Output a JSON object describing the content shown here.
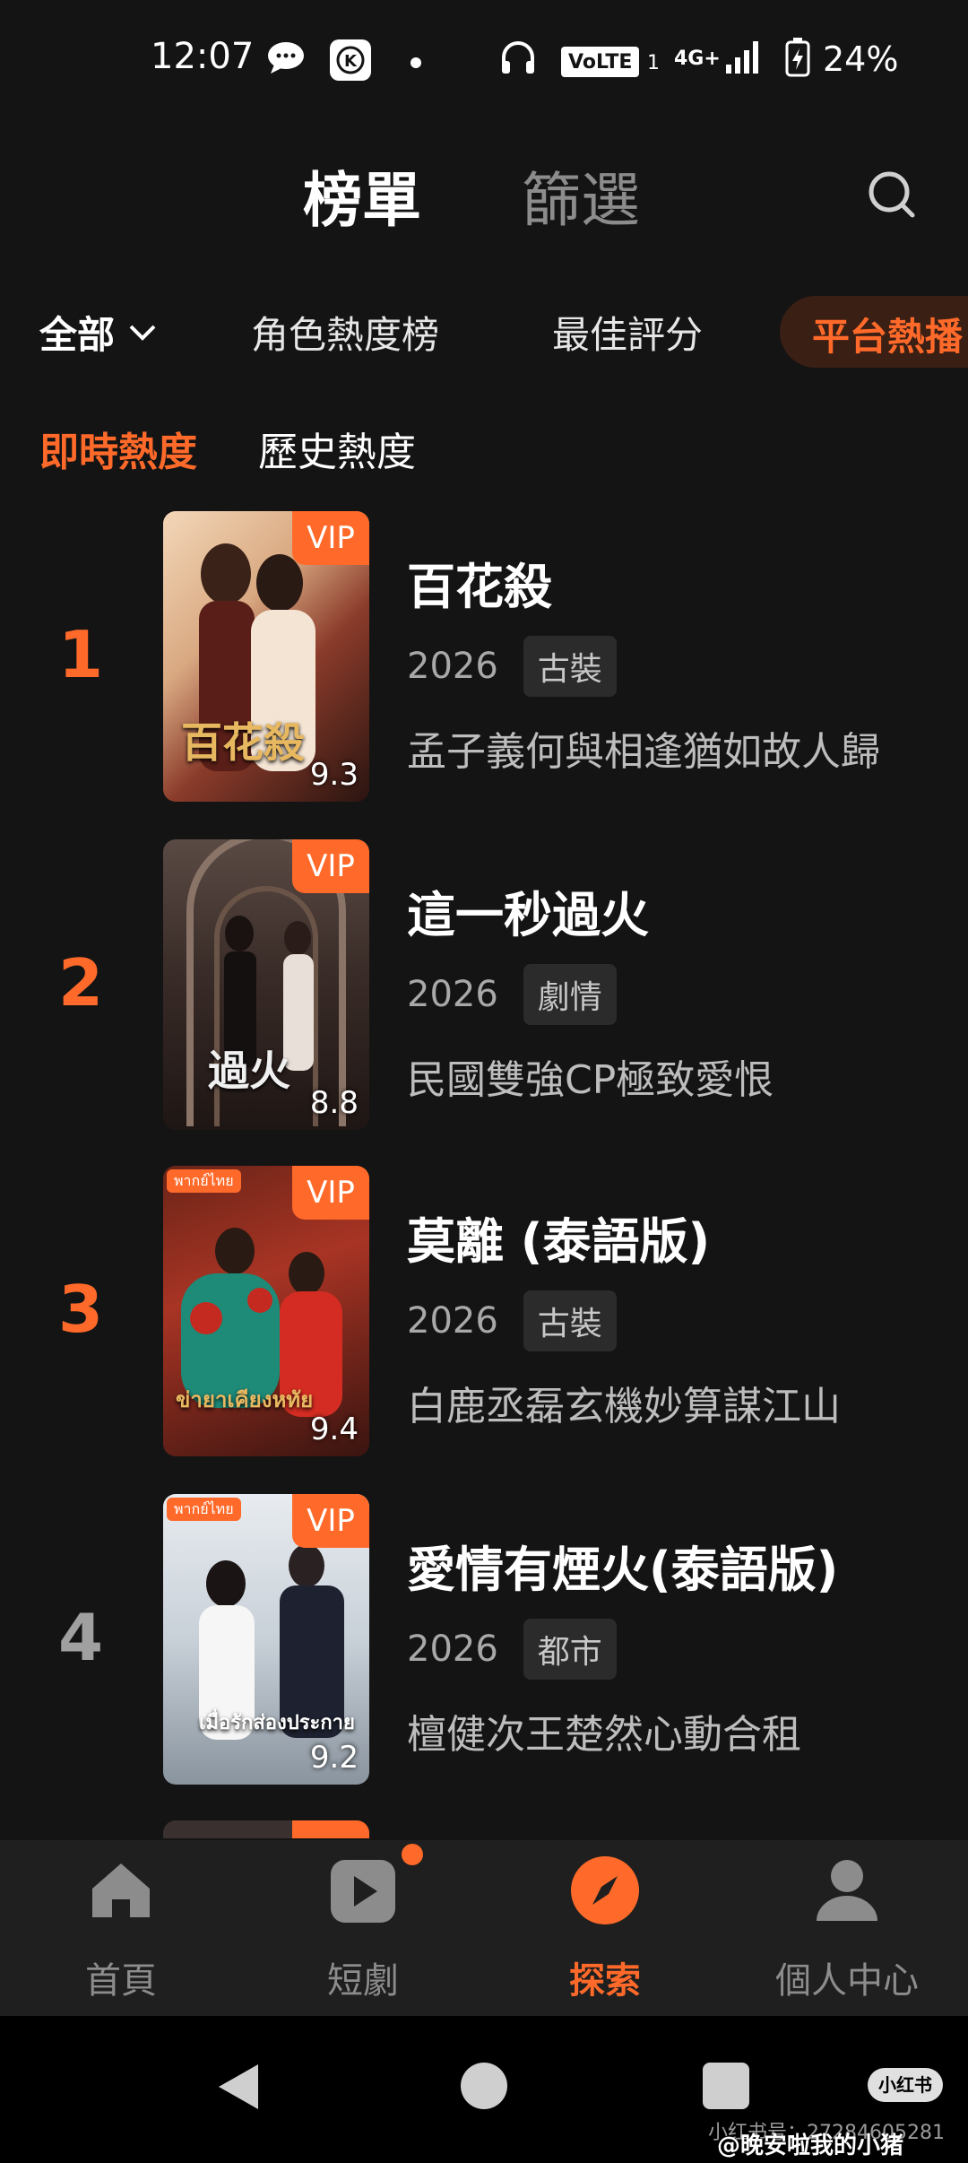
{
  "status_bar": {
    "time": "12:07",
    "volte": "VoLTE",
    "sim": "1",
    "network": "4G+",
    "battery_percent": "24%"
  },
  "header": {
    "tab_main": "榜單",
    "tab_filter": "篩選"
  },
  "categories": {
    "all": "全部",
    "items": [
      "角色熱度榜",
      "最佳評分",
      "平台熱播"
    ]
  },
  "subtabs": [
    "即時熱度",
    "歷史熱度"
  ],
  "vip_label": "VIP",
  "thai_tag": "พากย์ไทย",
  "list": [
    {
      "rank": "1",
      "title": "百花殺",
      "year": "2026",
      "genre": "古裝",
      "desc": "孟子義何與相逢猶如故人歸",
      "score": "9.3",
      "poster_text": "百花殺",
      "thai": false
    },
    {
      "rank": "2",
      "title": "這一秒過火",
      "year": "2026",
      "genre": "劇情",
      "desc": "民國雙強CP極致愛恨",
      "score": "8.8",
      "poster_text": "過火",
      "thai": false
    },
    {
      "rank": "3",
      "title": "莫離 (泰語版)",
      "year": "2026",
      "genre": "古裝",
      "desc": "白鹿丞磊玄機妙算謀江山",
      "score": "9.4",
      "poster_text": "ข่ายาเคียงหทัย",
      "thai": true
    },
    {
      "rank": "4",
      "title": "愛情有煙火(泰語版)",
      "year": "2026",
      "genre": "都市",
      "desc": "檀健次王楚然心動合租",
      "score": "9.2",
      "poster_text": "เมื่อรักส่องประกาย",
      "thai": true
    }
  ],
  "bottom_nav": [
    "首頁",
    "短劇",
    "探索",
    "個人中心"
  ],
  "watermark": {
    "badge": "小红书",
    "id": "小红书号：27284605281",
    "user": "@晚安啦我的小猪"
  },
  "colors": {
    "accent": "#ff6a2a",
    "background": "#141414",
    "nav_background": "#1f1f1f"
  }
}
